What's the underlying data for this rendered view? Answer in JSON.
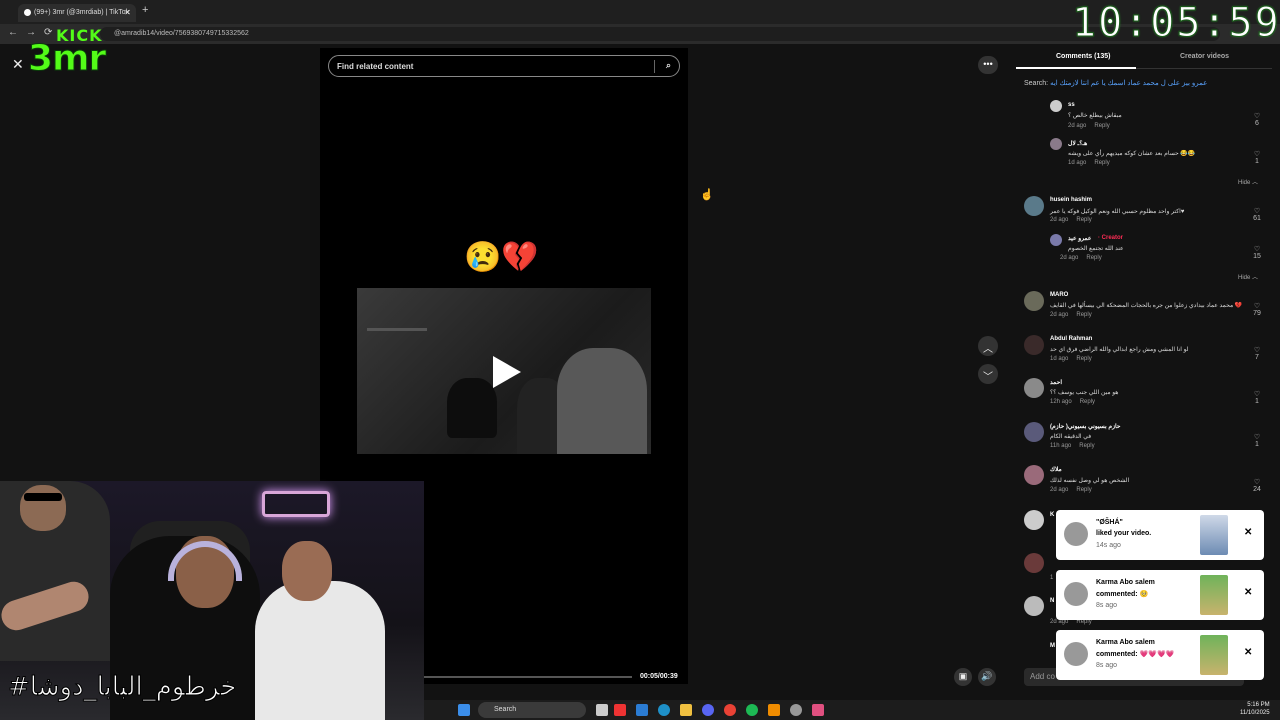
{
  "browser": {
    "tab_title": "(99+) 3mr (@3mrdiab) | TikTok",
    "new_tab": "+",
    "url": "@amradib14/video/7569380749715332562"
  },
  "overlay": {
    "kick_label": "KICK",
    "kick_logo": "3mr",
    "clock": "10:05:59",
    "hashtag": "#خرطوم_البابا_دوشا"
  },
  "video": {
    "search_placeholder": "Find related content",
    "emoji": "😢💔",
    "time": "00:05/00:39"
  },
  "comments_panel": {
    "tab_comments": "Comments (135)",
    "tab_creator": "Creator videos",
    "search_prefix": "Search:",
    "search_query": "عمرو بيز على ل محمد عماد اسمك يا عم انتا لازمتك ايه",
    "reply_label": "Reply",
    "hide_label": "Hide",
    "add_comment_placeholder": "Add co",
    "items": [
      {
        "name": "ss",
        "text": "مبقاش بيطلع خالص ؟",
        "time": "2d ago",
        "likes": "6"
      },
      {
        "name": "هـ؟ـ لال",
        "text": "حسام بعد عشان كوكه ميديهم رأي على ويشه 😂😂",
        "time": "1d ago",
        "likes": "1"
      },
      {
        "name": "husein hashim",
        "text": "اكتر واحد مظلوم حسبي الله ونعم الوكيل فوكه يا عمر♥",
        "time": "2d ago",
        "likes": "61"
      },
      {
        "name": "عمرو عيد",
        "creator": "· Creator",
        "text": "عند الله تجتمع الخصوم",
        "time": "2d ago",
        "likes": "15"
      },
      {
        "name": "MARO",
        "text": "محمد عماد بيدادي زعلوا من جره بالحجات المضحكة الي بيسألها في القايف 💔",
        "time": "2d ago",
        "likes": "79"
      },
      {
        "name": "Abdul Rahman",
        "text": "لو انا المشي ومش راجع ابدالي والله الراضي فرق اي حد",
        "time": "1d ago",
        "likes": "7"
      },
      {
        "name": "احمد",
        "text": "هو مين اللي جنب يوسف ؟؟",
        "time": "12h ago",
        "likes": "1"
      },
      {
        "name": "حازم بسيوني بسيوني( حازم)",
        "text": "في الدقيقه الكام",
        "time": "11h ago",
        "likes": "1"
      },
      {
        "name": "ملاك",
        "text": "الشخص هو لي وصل نفسه لذلك",
        "time": "2d ago",
        "likes": "24"
      },
      {
        "name": "K",
        "text": "",
        "time": "",
        "likes": ""
      },
      {
        "name": "",
        "text": "",
        "time": "1",
        "likes": ""
      },
      {
        "name": "N",
        "text": "",
        "time": "2d ago",
        "likes": ""
      },
      {
        "name": "M",
        "text": "",
        "time": "",
        "likes": ""
      }
    ]
  },
  "notifications": [
    {
      "name": "\"ØŠHÁ\"",
      "action": "liked your video.",
      "time": "14s ago"
    },
    {
      "name": "Karma Abo salem",
      "action": "commented: 🥺",
      "time": "8s ago"
    },
    {
      "name": "Karma Abo salem",
      "action": "commented: 💗💗💗💗",
      "time": "8s ago"
    }
  ],
  "taskbar": {
    "search": "Search",
    "time": "5:16 PM",
    "date": "11/10/2025"
  },
  "colors": {
    "kick_green": "#53fc18",
    "creator_red": "#fe2c55",
    "link_blue": "#59a3ff"
  }
}
